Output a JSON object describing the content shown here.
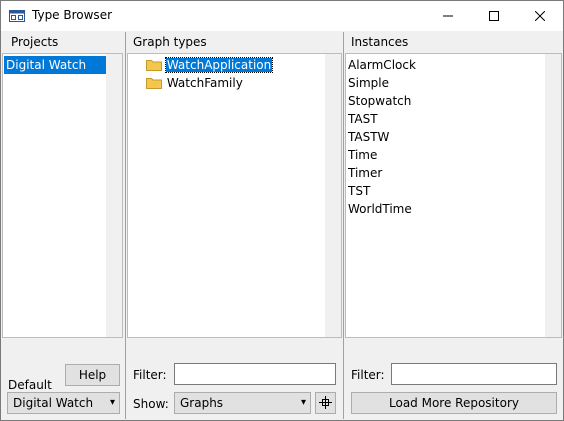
{
  "window": {
    "title": "Type Browser"
  },
  "projects": {
    "header": "Projects",
    "items": [
      "Digital Watch"
    ],
    "help_label": "Help",
    "default_label": "Default",
    "default_value": "Digital Watch"
  },
  "graph_types": {
    "header": "Graph types",
    "items": [
      "WatchApplication",
      "WatchFamily"
    ],
    "filter_label": "Filter:",
    "filter_value": "",
    "show_label": "Show:",
    "show_value": "Graphs"
  },
  "instances": {
    "header": "Instances",
    "items": [
      "AlarmClock",
      "Simple",
      "Stopwatch",
      "TAST",
      "TASTW",
      "Time",
      "Timer",
      "TST",
      "WorldTime"
    ],
    "filter_label": "Filter:",
    "filter_value": "",
    "load_button": "Load More Repository"
  },
  "colors": {
    "selection": "#0078d7",
    "folder": "#f3c74e"
  },
  "icons": {
    "app": "window-app-icon",
    "folder": "folder-icon",
    "minimize": "minimize-icon",
    "maximize": "maximize-icon",
    "close": "close-icon",
    "locate": "locate-icon"
  }
}
